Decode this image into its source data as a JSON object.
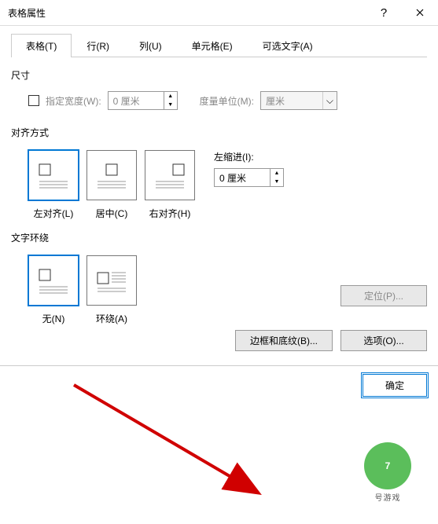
{
  "titlebar": {
    "title": "表格属性",
    "help": "?",
    "close": "×"
  },
  "tabs": [
    "表格(T)",
    "行(R)",
    "列(U)",
    "单元格(E)",
    "可选文字(A)"
  ],
  "size": {
    "group": "尺寸",
    "chk_label": "指定宽度(W):",
    "width_value": "0 厘米",
    "unit_label": "度量单位(M):",
    "unit_value": "厘米"
  },
  "align": {
    "group": "对齐方式",
    "opts": [
      "左对齐(L)",
      "居中(C)",
      "右对齐(H)"
    ],
    "indent_label": "左缩进(I):",
    "indent_value": "0 厘米"
  },
  "wrap": {
    "group": "文字环绕",
    "opts": [
      "无(N)",
      "环绕(A)"
    ],
    "locate_btn": "定位(P)..."
  },
  "bottom": {
    "border_btn": "边框和底纹(B)...",
    "options_btn": "选项(O)..."
  },
  "footer": {
    "ok": "确定"
  },
  "watermark": {
    "num": "7",
    "brand": "号游戏"
  }
}
